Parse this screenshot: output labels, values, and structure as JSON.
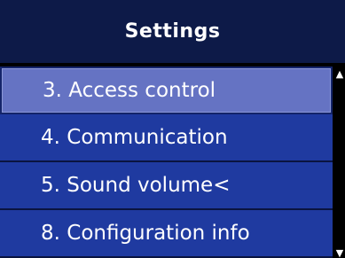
{
  "header": {
    "title": "Settings"
  },
  "menu": {
    "items": [
      {
        "label": "3. Access control"
      },
      {
        "label": "4. Communication"
      },
      {
        "label": "5. Sound volume<"
      },
      {
        "label": "8. Configuration info"
      }
    ]
  },
  "scroll": {
    "up_icon": "▲",
    "down_icon": "▼"
  },
  "colors": {
    "header_bg": "#0d1a48",
    "item_bg": "#1f3aa0",
    "selected_bg": "#6573c3",
    "text": "#ffffff"
  }
}
